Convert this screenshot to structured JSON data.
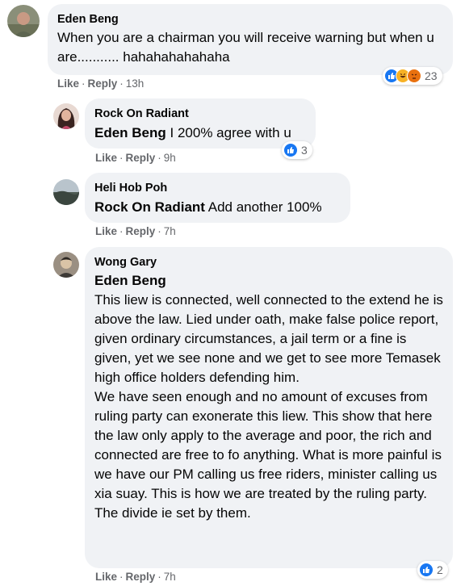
{
  "colors": {
    "bubble": "#f0f2f5",
    "meta_text": "#65676b",
    "like_blue": "#1877f2",
    "love_red": "#f33e58",
    "angry_orange": "#e9710f"
  },
  "comments": [
    {
      "author": "Eden Beng",
      "text": "When you are a chairman you will receive warning but when u are........... hahahahahahaha",
      "like_label": "Like",
      "reply_label": "Reply",
      "time": "13h",
      "reactions": [
        "like-icon",
        "haha-icon",
        "angry-icon"
      ],
      "reaction_count": "23"
    },
    {
      "author": "Rock On Radiant",
      "tag": "Eden Beng",
      "text": " I 200% agree with u",
      "like_label": "Like",
      "reply_label": "Reply",
      "time": "9h",
      "reactions": [
        "like-icon"
      ],
      "reaction_count": "3"
    },
    {
      "author": "Heli Hob Poh",
      "tag": "Rock On Radiant",
      "text": " Add another 100%",
      "like_label": "Like",
      "reply_label": "Reply",
      "time": "7h"
    },
    {
      "author": "Wong Gary",
      "tag": "Eden Beng",
      "paragraph1": "This liew is connected, well connected to the extend he is above the law. Lied under oath, make false police report, given ordinary circumstances, a jail term or a fine is given, yet we see none and we get to see more Temasek high office holders defending him.",
      "paragraph2": "We have seen enough and no amount of excuses from ruling party can exonerate this liew. This show that here the law only apply to the average and poor, the rich and connected are free to fo anything. What is more painful is we have our PM calling us free riders, minister calling us xia suay. This is how we are treated by the ruling party. The divide ie set by them.",
      "like_label": "Like",
      "reply_label": "Reply",
      "time": "7h",
      "reactions": [
        "like-icon"
      ],
      "reaction_count": "2"
    }
  ]
}
